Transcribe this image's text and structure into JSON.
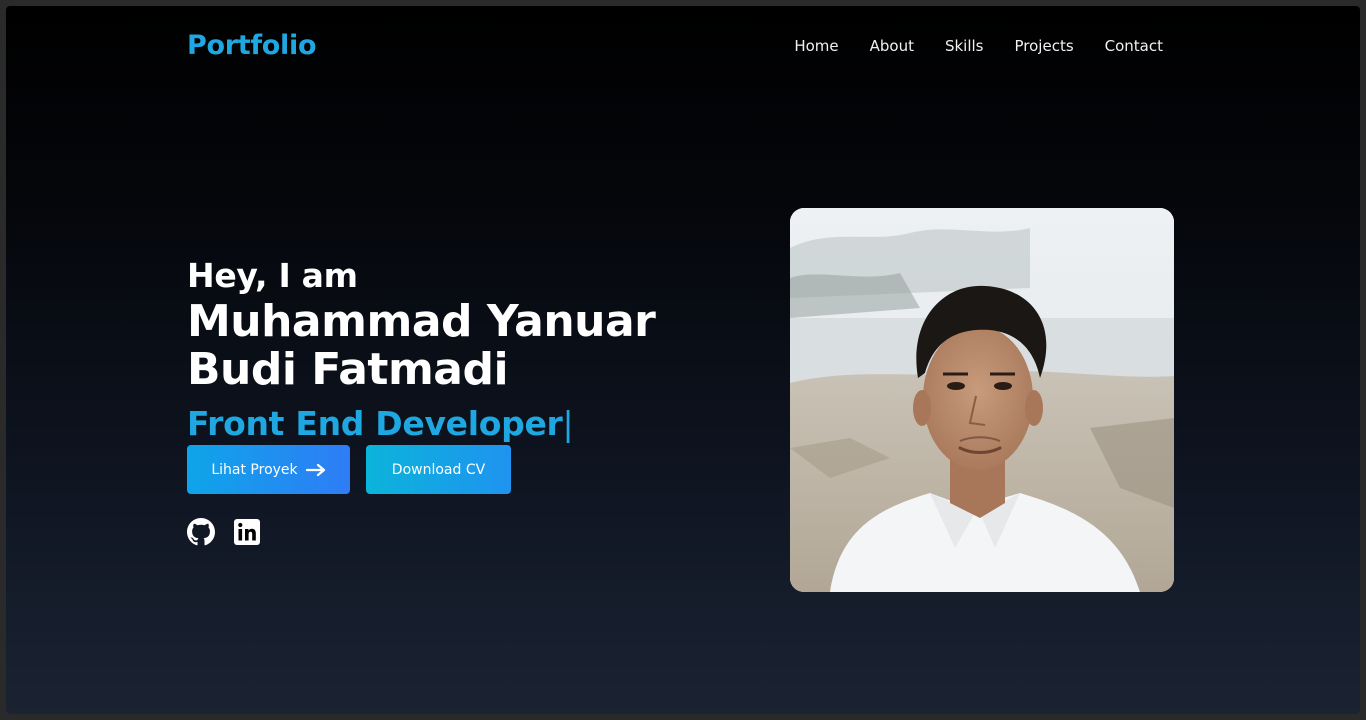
{
  "nav": {
    "brand": "Portfolio",
    "links": [
      "Home",
      "About",
      "Skills",
      "Projects",
      "Contact"
    ]
  },
  "hero": {
    "greeting": "Hey, I am",
    "name": "Muhammad Yanuar Budi Fatmadi",
    "role": "Front End Developer",
    "cursor": "|",
    "primary_button": "Lihat Proyek",
    "secondary_button": "Download CV"
  },
  "socials": [
    {
      "icon": "github-icon"
    },
    {
      "icon": "linkedin-icon"
    }
  ],
  "colors": {
    "accent": "#1ea7e0",
    "button_start": "#0ea5e9",
    "button_end": "#2f7cf6",
    "background_top": "#000000",
    "background_bottom": "#1b2333"
  }
}
